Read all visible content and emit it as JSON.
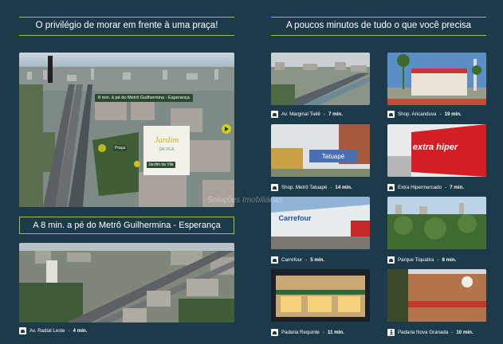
{
  "left_header": "O privilégio de morar em frente à uma praça!",
  "right_header": "A poucos minutos de tudo o que você precisa",
  "map_labels": {
    "metro": "8 min. à pé do Metrô Guilhermina - Esperança",
    "logo_title": "Jardim",
    "logo_sub": "DA VILA",
    "icon_text_1": "Praça",
    "icon_text_2": "Jardim da Vila"
  },
  "middle_banner": "A 8 min. a pé do Metrô Guilhermina - Esperança",
  "bottom_left_caption": {
    "name": "Av. Radial Leste",
    "time": "4 min.",
    "icon": "car-icon"
  },
  "watermark": "Soluções Imobiliárias",
  "places": [
    {
      "name": "Av. Marginal Tietê",
      "time": "7 min.",
      "icon": "car-icon"
    },
    {
      "name": "Shop. Aricanduva",
      "time": "19 min.",
      "icon": "car-icon"
    },
    {
      "name": "Shop. Metrô Tatuapé",
      "time": "14 min.",
      "icon": "car-icon",
      "photo_text": "Tatuapé"
    },
    {
      "name": "Extra Hipermercado",
      "time": "7 min.",
      "icon": "car-icon",
      "photo_text": "extra hiper"
    },
    {
      "name": "Carrefour",
      "time": "5 min.",
      "icon": "car-icon",
      "photo_text": "Carrefour"
    },
    {
      "name": "Parque Tiquatira",
      "time": "8 min.",
      "icon": "car-icon"
    },
    {
      "name": "Padaria Requinte",
      "time": "11 min.",
      "icon": "car-icon"
    },
    {
      "name": "Padaria Nova Granada",
      "time": "10 min.",
      "icon": "walk-icon"
    }
  ],
  "colors": {
    "background": "#1d3a4a",
    "accent": "#a6c23a"
  }
}
